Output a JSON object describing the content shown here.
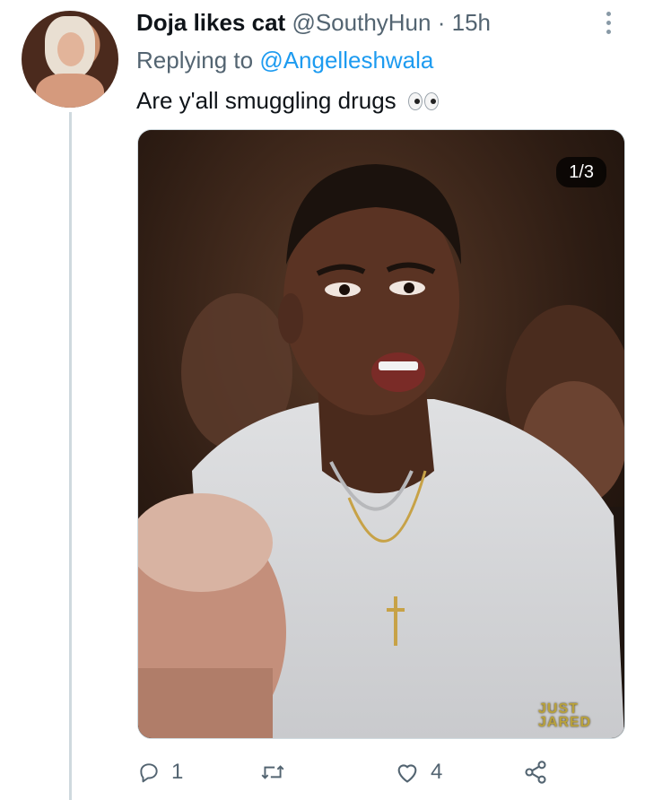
{
  "tweet": {
    "display_name": "Doja likes cat",
    "handle": "@SouthyHun",
    "separator": "·",
    "time": "15h",
    "replying_prefix": "Replying to",
    "replying_handle": "@Angelleshwala",
    "text": "Are y'all smuggling drugs",
    "emoji": "eyes-emoji",
    "colors": {
      "link": "#1d9bf0",
      "secondary": "#536471",
      "text": "#0f1419",
      "thread_line": "#cfd9de"
    }
  },
  "media": {
    "counter": "1/3",
    "watermark_line1": "JUST",
    "watermark_line2": "JARED"
  },
  "actions": {
    "reply_count": "1",
    "retweet_count": "",
    "like_count": "4",
    "icons": [
      "reply-icon",
      "retweet-icon",
      "like-icon",
      "share-icon"
    ]
  }
}
